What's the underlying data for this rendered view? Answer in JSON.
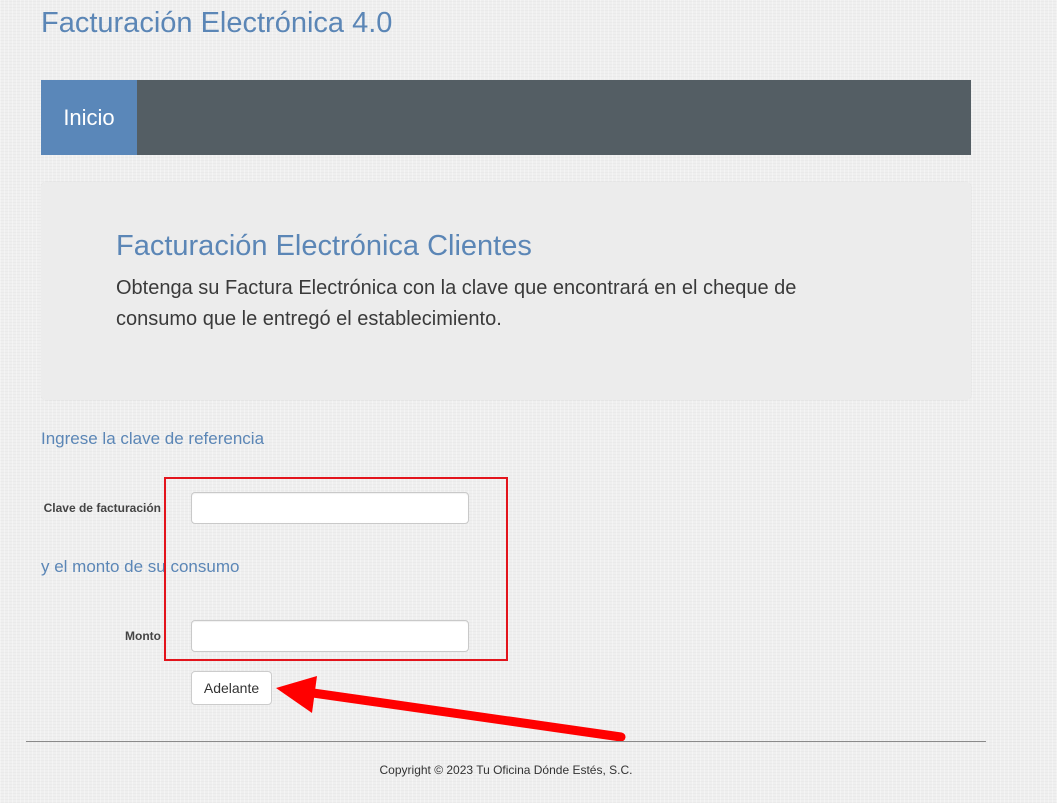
{
  "header": {
    "site_title": "Facturación Electrónica 4.0"
  },
  "nav": {
    "items": [
      {
        "label": "Inicio",
        "active": true
      }
    ]
  },
  "jumbotron": {
    "title": "Facturación Electrónica Clientes",
    "text": "Obtenga su Factura Electrónica con la clave que encontrará en el cheque de consumo que le entregó el establecimiento."
  },
  "form": {
    "reference_prompt": "Ingrese la clave de referencia",
    "clave_label": "Clave de facturación",
    "clave_value": "",
    "amount_prompt": "y el monto de su consumo",
    "monto_label": "Monto",
    "monto_value": "",
    "submit_label": "Adelante"
  },
  "annotations": {
    "highlight_color": "#e3141c",
    "arrow_color": "#ff0000"
  },
  "footer": {
    "copyright": "Copyright © 2023 Tu Oficina Dónde Estés, S.C."
  },
  "colors": {
    "accent": "#5a87b9",
    "navbar": "#545e64",
    "jumbotron": "#ececec",
    "background": "#efefef"
  }
}
